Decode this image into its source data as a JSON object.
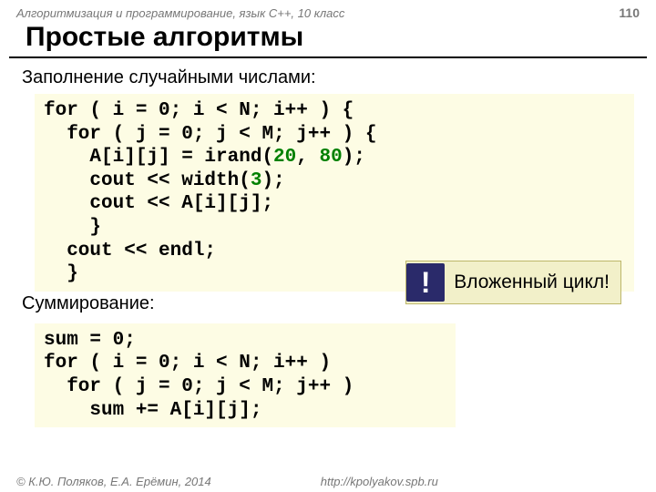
{
  "header": {
    "course": "Алгоритмизация и программирование, язык C++, 10 класс",
    "page_number": "110"
  },
  "title": "Простые алгоритмы",
  "sections": {
    "fill": {
      "heading": "Заполнение случайными числами:",
      "code": {
        "l1a": "for ( i = 0; i < N; i++ ) {",
        "l2a": "  for ( j = 0; j < M; j++ ) {",
        "l3a": "    A[i][j] = irand(",
        "l3b": "20",
        "l3c": ", ",
        "l3d": "80",
        "l3e": ");",
        "l4": "    cout << width(",
        "l4b": "3",
        "l4c": ");",
        "l5": "    cout << A[i][j];",
        "l6": "    }",
        "l7": "  cout << endl;",
        "l8": "  }"
      }
    },
    "sum": {
      "heading": "Суммирование:",
      "code": {
        "l1": "sum = 0;",
        "l2": "for ( i = 0; i < N; i++ )",
        "l3": "  for ( j = 0; j < M; j++ )",
        "l4": "    sum += A[i][j];"
      }
    }
  },
  "callout": {
    "icon": "!",
    "text": "Вложенный цикл!"
  },
  "footer": {
    "copyright": "© К.Ю. Поляков, Е.А. Ерёмин, 2014",
    "url": "http://kpolyakov.spb.ru"
  }
}
